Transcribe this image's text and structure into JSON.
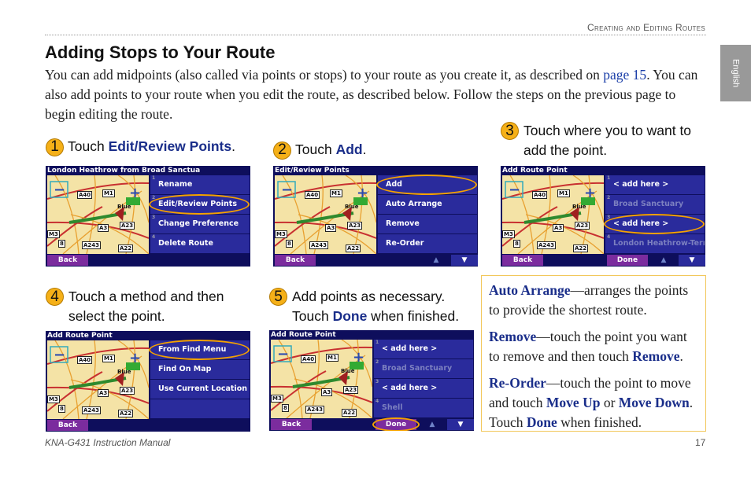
{
  "header": {
    "section": "Creating and Editing Routes",
    "language_tab": "English"
  },
  "title": "Adding Stops to Your Route",
  "intro": {
    "before": "You can add midpoints (also called via points or stops) to your route as you create it, as described on ",
    "link": "page 15",
    "after": ". You can also add points to your route when you edit the route, as described below. Follow the steps on the previous page to begin editing the route."
  },
  "steps": [
    {
      "num": "1",
      "pre": "Touch ",
      "bold": "Edit/Review Points",
      "post": "."
    },
    {
      "num": "2",
      "pre": "Touch ",
      "bold": "Add",
      "post": "."
    },
    {
      "num": "3",
      "pre": "Touch where you to want to add the point.",
      "bold": "",
      "post": ""
    },
    {
      "num": "4",
      "pre": "Touch a method and then select the point.",
      "bold": "",
      "post": ""
    },
    {
      "num": "5",
      "pre": "Add points as necessary. Touch ",
      "bold": "Done",
      "post": " when finished."
    }
  ],
  "map_labels": [
    "A40",
    "M1",
    "A3",
    "A23",
    "M3",
    "A243",
    "A22",
    "Blue",
    "8"
  ],
  "screens": [
    {
      "title": "London Heathrow from Broad Sanctua",
      "items": [
        {
          "n": "1",
          "label": "Rename"
        },
        {
          "n": "2",
          "label": "Edit/Review Points",
          "hl": true
        },
        {
          "n": "3",
          "label": "Change Preference"
        },
        {
          "n": "4",
          "label": "Delete Route"
        }
      ],
      "back": "Back",
      "done": "",
      "arrows": false
    },
    {
      "title": "Edit/Review Points",
      "items": [
        {
          "n": "",
          "label": "Add",
          "hl": true
        },
        {
          "n": "",
          "label": "Auto Arrange"
        },
        {
          "n": "",
          "label": "Remove"
        },
        {
          "n": "",
          "label": "Re-Order"
        }
      ],
      "back": "Back",
      "done": "",
      "arrows": true
    },
    {
      "title": "Add Route Point",
      "items": [
        {
          "n": "1",
          "label": "< add here >"
        },
        {
          "n": "2",
          "label": "Broad Sanctuary",
          "dim": true
        },
        {
          "n": "3",
          "label": "< add here >",
          "hl": true
        },
        {
          "n": "4",
          "label": "London Heathrow-Termi",
          "dim": true
        }
      ],
      "back": "Back",
      "done": "Done",
      "arrows": true
    },
    {
      "title": "Add Route Point",
      "items": [
        {
          "n": "",
          "label": "From Find Menu",
          "hl": true
        },
        {
          "n": "",
          "label": "Find On Map"
        },
        {
          "n": "",
          "label": "Use Current Location"
        },
        {
          "n": "",
          "label": ""
        }
      ],
      "back": "Back",
      "done": "",
      "arrows": false
    },
    {
      "title": "Add Route Point",
      "items": [
        {
          "n": "1",
          "label": "< add here >"
        },
        {
          "n": "2",
          "label": "Broad Sanctuary",
          "dim": true
        },
        {
          "n": "3",
          "label": "< add here >"
        },
        {
          "n": "4",
          "label": "Shell",
          "dim": true
        }
      ],
      "back": "Back",
      "done": "Done",
      "done_hl": true,
      "arrows": true
    }
  ],
  "info": [
    {
      "term": "Auto Arrange",
      "text": "—arranges the points to provide the shortest route."
    },
    {
      "term": "Remove",
      "text": "—touch the point you want to remove and then touch ",
      "term2": "Remove",
      "text2": "."
    },
    {
      "term": "Re-Order",
      "text": "—touch the point to move and touch ",
      "term2": "Move Up",
      "text2": " or ",
      "term3": "Move Down",
      "text3": ". Touch ",
      "term4": "Done",
      "text4": " when finished."
    }
  ],
  "footer": {
    "manual": "KNA-G431 Instruction Manual",
    "page": "17"
  },
  "colors": {
    "accent_blue": "#1a2e8a",
    "step_circle": "#f5b018",
    "highlight": "#f5a200",
    "screen_bg": "#0e0e5c",
    "menu_button": "#2a2b9c",
    "back_button": "#7b2c9e"
  }
}
